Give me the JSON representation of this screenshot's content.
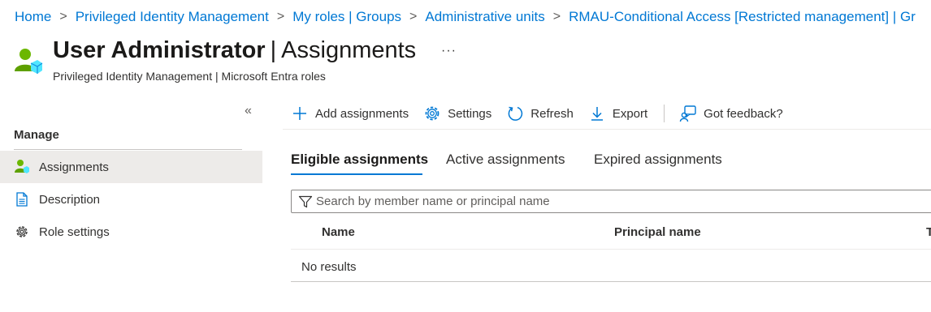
{
  "breadcrumb": {
    "items": [
      "Home",
      "Privileged Identity Management",
      "My roles | Groups",
      "Administrative units",
      "RMAU-Conditional Access [Restricted management] | Gr"
    ]
  },
  "header": {
    "title_bold": "User Administrator",
    "title_pipe": "|",
    "title_rest": "Assignments",
    "more": "···",
    "subtitle": "Privileged Identity Management | Microsoft Entra roles"
  },
  "sidebar": {
    "collapse_glyph": "«",
    "manage_heading": "Manage",
    "items": [
      {
        "label": "Assignments",
        "icon": "user-role-icon",
        "selected": true
      },
      {
        "label": "Description",
        "icon": "document-icon",
        "selected": false
      },
      {
        "label": "Role settings",
        "icon": "gear-icon",
        "selected": false
      }
    ]
  },
  "toolbar": {
    "add_label": "Add assignments",
    "settings_label": "Settings",
    "refresh_label": "Refresh",
    "export_label": "Export",
    "feedback_label": "Got feedback?"
  },
  "tabs": [
    {
      "label": "Eligible assignments",
      "active": true
    },
    {
      "label": "Active assignments",
      "active": false
    },
    {
      "label": "Expired assignments",
      "active": false
    }
  ],
  "search": {
    "placeholder": "Search by member name or principal name",
    "value": ""
  },
  "table": {
    "columns": [
      "Name",
      "Principal name",
      "T"
    ],
    "empty_text": "No results"
  },
  "colors": {
    "accent": "#0078d4",
    "selected_nav": "#edebe9",
    "user_icon_green": "#6bb700"
  }
}
